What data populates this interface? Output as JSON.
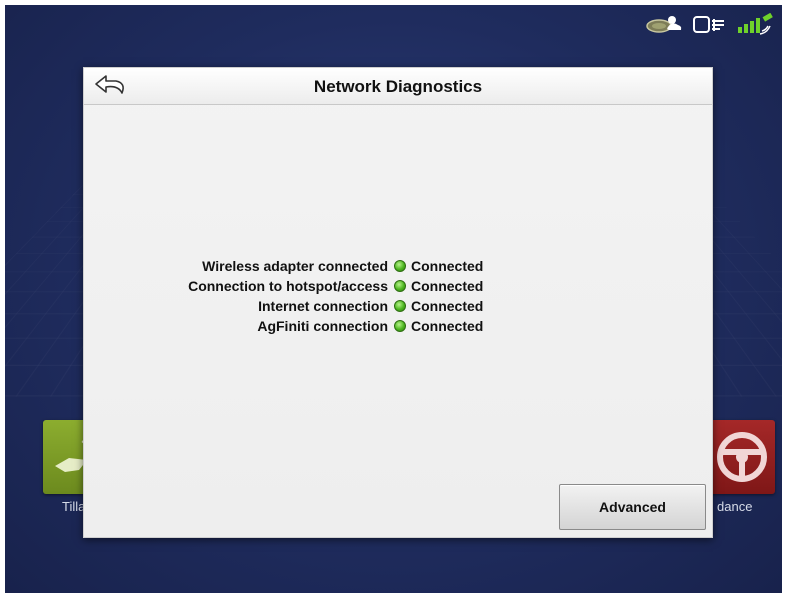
{
  "dialog": {
    "title": "Network Diagnostics",
    "back_icon": "back-arrow-icon"
  },
  "status_rows": [
    {
      "label": "Wireless adapter connected",
      "status": "Connected",
      "status_color": "#4cb51f"
    },
    {
      "label": "Connection to hotspot/access",
      "status": "Connected",
      "status_color": "#4cb51f"
    },
    {
      "label": "Internet connection",
      "status": "Connected",
      "status_color": "#4cb51f"
    },
    {
      "label": "AgFiniti connection",
      "status": "Connected",
      "status_color": "#4cb51f"
    }
  ],
  "buttons": {
    "advanced_label": "Advanced"
  },
  "background_tiles": {
    "left_label": "Tilla",
    "right_label": "dance"
  },
  "status_bar_icons": [
    "cloud-sync-icon",
    "display-link-icon",
    "gps-satellite-icon"
  ],
  "colors": {
    "screen_bg": "#1f2c5e",
    "tile_left": "#7a9a25",
    "tile_right": "#8f1f1f"
  }
}
